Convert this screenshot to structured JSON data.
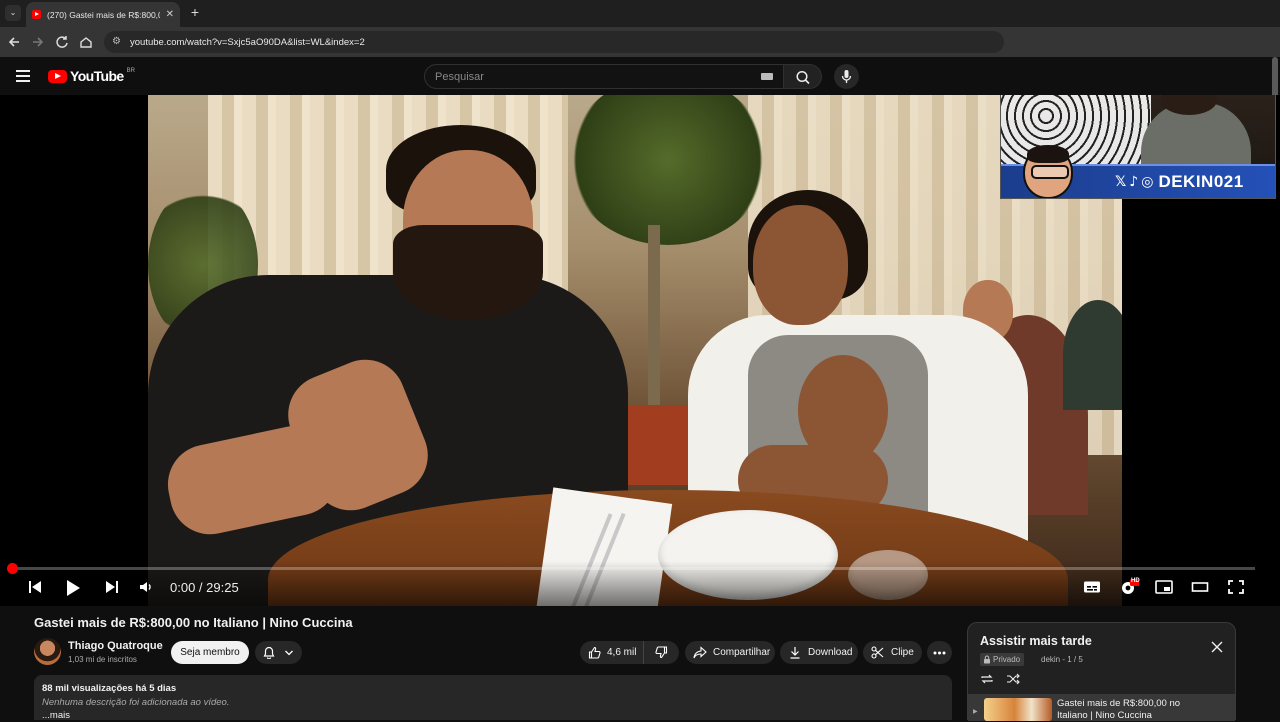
{
  "browser": {
    "tab_title": "(270) Gastei mais de R$:800,00 n",
    "url": "youtube.com/watch?v=Sxjc5aO90DA&list=WL&index=2"
  },
  "header": {
    "logo_text": "YouTube",
    "country_code": "BR",
    "search_placeholder": "Pesquisar"
  },
  "player": {
    "time": "0:00 / 29:25",
    "progress_fraction": 0.0,
    "quality_badge": "HD"
  },
  "overlay": {
    "handle": "DEKIN021"
  },
  "video": {
    "title": "Gastei mais de R$:800,00 no Italiano | Nino Cuccina",
    "channel_name": "Thiago Quatroque",
    "subscribers": "1,03 mi de inscritos",
    "join_label": "Seja membro",
    "likes": "4,6 mil",
    "share_label": "Compartilhar",
    "download_label": "Download",
    "clip_label": "Clipe"
  },
  "description": {
    "stats": "88 mil visualizações  há 5 dias",
    "text": "Nenhuma descrição foi adicionada ao vídeo.",
    "more": "...mais"
  },
  "playlist": {
    "title": "Assistir mais tarde",
    "privacy": "Privado",
    "owner_position": "dekin - 1 / 5",
    "items": [
      {
        "title": "Gastei mais de R$:800,00 no Italiano | Nino Cuccina"
      }
    ]
  },
  "colors": {
    "accent_red": "#ff0000",
    "background": "#0f0f0f",
    "overlay_banner": "#2451b8"
  }
}
